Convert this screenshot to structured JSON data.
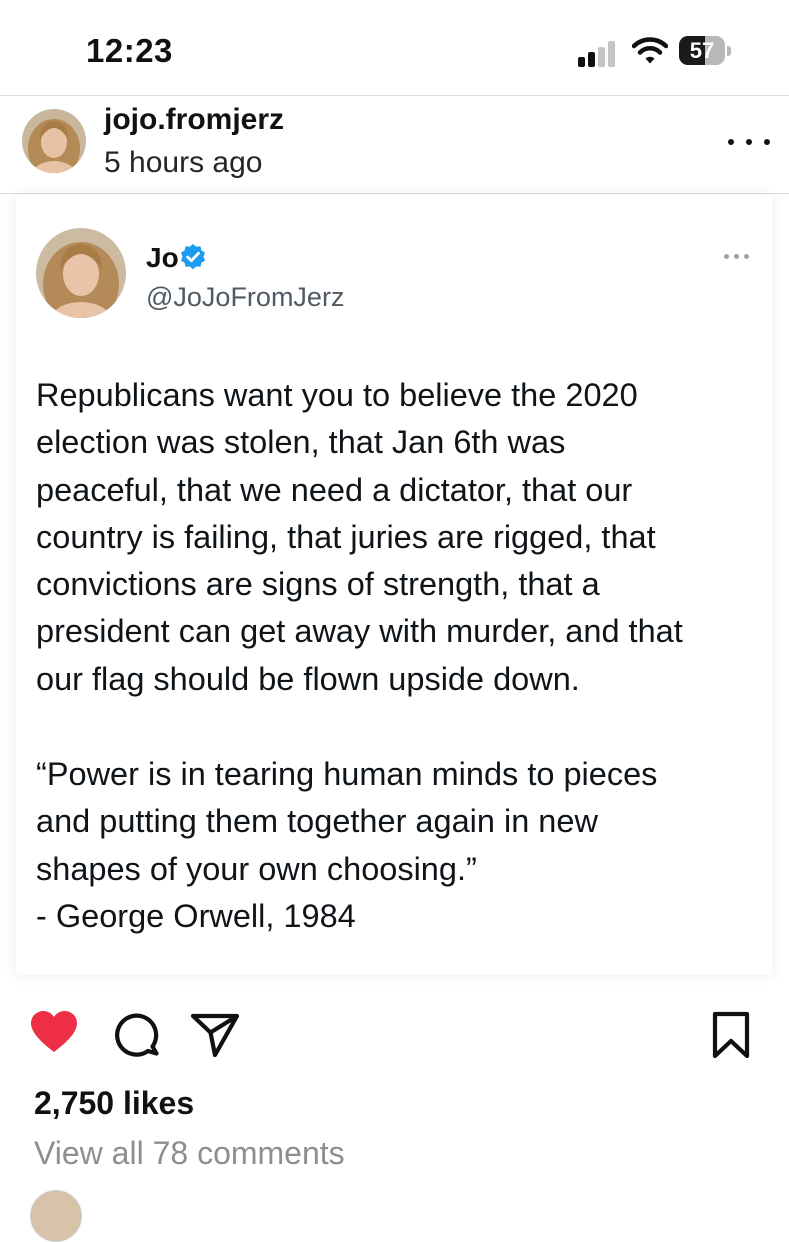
{
  "status_bar": {
    "time": "12:23",
    "battery_level": 57,
    "battery_label": "57",
    "signal_bars": 2,
    "icons": [
      "cellular-signal-icon",
      "wifi-icon",
      "battery-icon"
    ]
  },
  "post": {
    "username": "jojo.fromjerz",
    "timestamp": "5 hours ago",
    "more_icon": "more-horizontal-icon"
  },
  "tweet": {
    "display_name": "Jo",
    "verified": true,
    "handle": "@JoJoFromJerz",
    "body": "Republicans want you to believe the 2020\nelection was stolen, that Jan 6th was\npeaceful, that we need a dictator, that our\ncountry is failing, that juries are rigged, that\nconvictions are signs of strength, that a\npresident can get away with murder, and that\nour flag should be flown upside down.",
    "quote": "“Power is in tearing human minds to pieces\nand putting them together again in new\nshapes of your own choosing.”\n- George Orwell, 1984"
  },
  "actions": {
    "liked": true,
    "icons": [
      "heart-icon",
      "comment-icon",
      "share-icon",
      "bookmark-icon"
    ]
  },
  "engagement": {
    "likes": "2,750 likes",
    "view_comments": "View all 78 comments"
  },
  "colors": {
    "like_red": "#ed2e45",
    "verified_blue": "#1d9bf0",
    "muted_gray": "#8e8e8e",
    "handle_gray": "#505a64",
    "divider": "#dedede"
  }
}
